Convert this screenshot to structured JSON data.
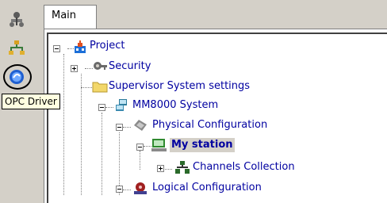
{
  "toolbar": {
    "buttons": [
      {
        "icon": "network-tree-icon"
      },
      {
        "icon": "hierarchy-icon"
      },
      {
        "icon": "opc-driver-icon"
      }
    ],
    "tooltip": "OPC Driver"
  },
  "tabs": [
    {
      "label": "Main"
    }
  ],
  "tree": {
    "nodes": [
      {
        "label": "Project",
        "icon": "project-icon",
        "expander": "minus",
        "selected": false
      },
      {
        "label": "Security",
        "icon": "security-icon",
        "expander": "plus",
        "selected": false
      },
      {
        "label": "Supervisor System settings",
        "icon": "folder-icon",
        "expander": "none",
        "selected": false
      },
      {
        "label": "MM8000 System",
        "icon": "system-icon",
        "expander": "minus",
        "selected": false
      },
      {
        "label": "Physical Configuration",
        "icon": "physical-config-icon",
        "expander": "minus",
        "selected": false
      },
      {
        "label": "My station",
        "icon": "station-icon",
        "expander": "minus",
        "selected": true
      },
      {
        "label": "Channels Collection",
        "icon": "channels-icon",
        "expander": "plus",
        "selected": false
      },
      {
        "label": "Logical Configuration",
        "icon": "logical-config-icon",
        "expander": "minus",
        "selected": false
      }
    ]
  }
}
